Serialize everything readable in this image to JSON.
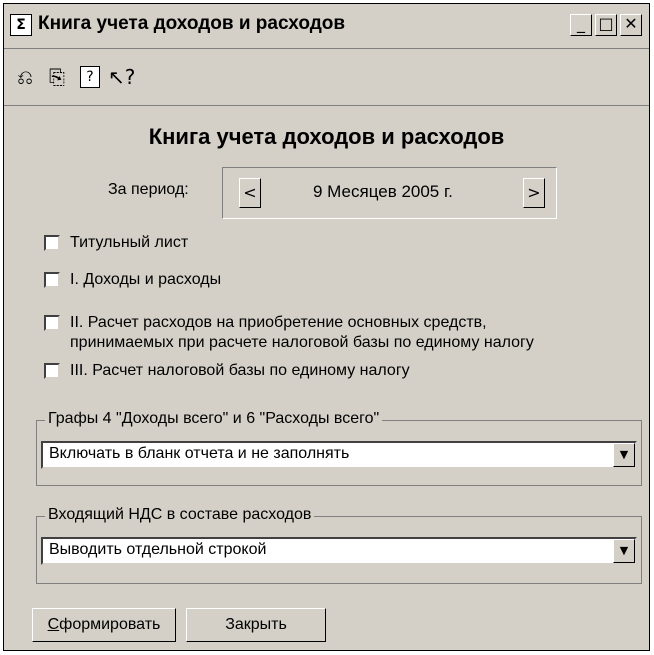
{
  "window": {
    "title": "Книга учета доходов и расходов",
    "minimize": "_",
    "maximize": "□",
    "close": "✕",
    "app_icon": "calculator-icon"
  },
  "toolbar": {
    "icons": [
      "open-document-icon",
      "save-document-icon",
      "help-icon",
      "context-help-icon"
    ],
    "glyphs": [
      "⎌",
      "⎘",
      "?",
      "↖?"
    ]
  },
  "form": {
    "heading": "Книга учета доходов и расходов",
    "period_label": "За период:",
    "period_value": "9 Месяцев 2005 г.",
    "prev": "<",
    "next": ">"
  },
  "checkboxes": [
    {
      "label": "Титульный лист",
      "checked": false
    },
    {
      "label": "I. Доходы и расходы",
      "checked": false
    },
    {
      "label": "II. Расчет расходов на приобретение основных средств,",
      "label2": "принимаемых при расчете налоговой базы по единому налогу",
      "checked": false
    },
    {
      "label": "III. Расчет налоговой базы по единому налогу",
      "checked": false
    }
  ],
  "groups": {
    "columns": {
      "title": "Графы 4 \"Доходы всего\" и 6 \"Расходы всего\"",
      "value": "Включать в бланк отчета и не заполнять",
      "arrow": "▼"
    },
    "vat": {
      "title": "Входящий НДС в составе расходов",
      "value": "Выводить отдельной строкой",
      "arrow": "▼"
    }
  },
  "buttons": {
    "generate_first": "С",
    "generate_rest": "формировать",
    "close": "Закрыть"
  }
}
